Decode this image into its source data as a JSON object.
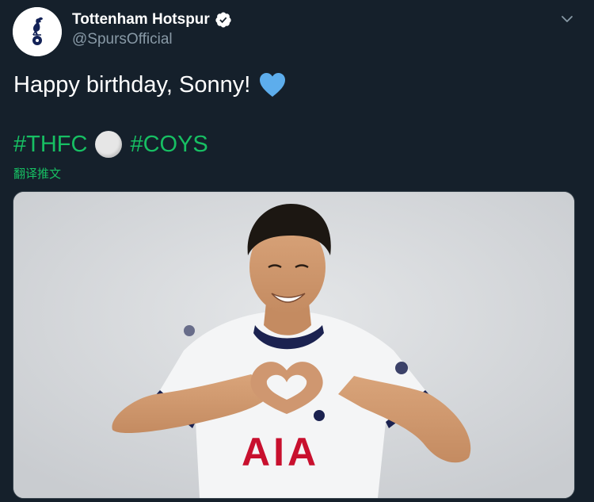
{
  "account": {
    "display_name": "Tottenham Hotspur",
    "handle": "@SpursOfficial",
    "verified": true
  },
  "tweet": {
    "text": "Happy birthday, Sonny!",
    "emoji": "blue-heart",
    "hashtags": [
      "#THFC",
      "#COYS"
    ],
    "separator_emoji": "white-circle",
    "translate_label": "翻译推文"
  },
  "media": {
    "type": "photo",
    "shirt_sponsor": "AIA"
  },
  "colors": {
    "background": "#15202b",
    "text": "#ffffff",
    "secondary": "#8899a6",
    "hashtag": "#17bf63",
    "heart": "#5dadec",
    "verified_badge": "#ffffff"
  },
  "icons": {
    "avatar": "spurs-cockerel-logo",
    "verified": "verified-badge-icon",
    "menu": "chevron-down-icon"
  }
}
